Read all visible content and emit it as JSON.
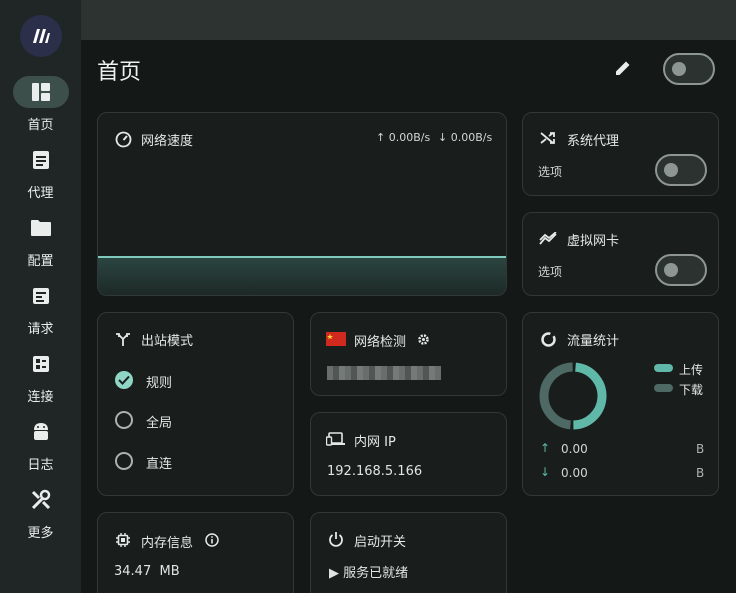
{
  "sidebar": {
    "items": [
      {
        "label": "首页",
        "icon": "dashboard-icon",
        "active": true
      },
      {
        "label": "代理",
        "icon": "document-icon"
      },
      {
        "label": "配置",
        "icon": "folder-icon"
      },
      {
        "label": "请求",
        "icon": "requests-icon"
      },
      {
        "label": "连接",
        "icon": "connections-icon"
      },
      {
        "label": "日志",
        "icon": "android-icon"
      },
      {
        "label": "更多",
        "icon": "tools-icon"
      }
    ]
  },
  "header": {
    "title": "首页",
    "toggle_on": false
  },
  "speed": {
    "title": "网络速度",
    "up": "↑ 0.00B/s",
    "down": "↓ 0.00B/s"
  },
  "system_proxy": {
    "title": "系统代理",
    "option": "选项",
    "enabled": false
  },
  "tun": {
    "title": "虚拟网卡",
    "option": "选项",
    "enabled": false
  },
  "outbound": {
    "title": "出站模式",
    "options": [
      "规则",
      "全局",
      "直连"
    ],
    "selected": 0
  },
  "netcheck": {
    "title": "网络检测"
  },
  "lan": {
    "title": "内网 IP",
    "value": "192.168.5.166"
  },
  "traffic": {
    "title": "流量统计",
    "legend_up": "上传",
    "legend_down": "下载",
    "up_value": "0.00",
    "down_value": "0.00",
    "up_unit": "B",
    "down_unit": "B"
  },
  "memory": {
    "title": "内存信息",
    "value": "34.47  MB"
  },
  "launch": {
    "title": "启动开关",
    "status": "▶ 服务已就绪"
  },
  "colors": {
    "accent": "#5fb8a8",
    "accent_dark": "#4a6e68",
    "bg": "#141817",
    "card": "#191d1c"
  }
}
